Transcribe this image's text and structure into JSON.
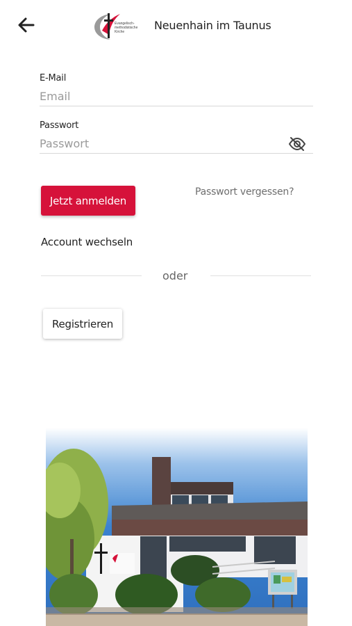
{
  "header": {
    "back_icon": "arrow-left-icon",
    "logo_text": [
      "Evangelisch-",
      "methodistische",
      "Kirche"
    ],
    "title": "Neuenhain im Taunus"
  },
  "login": {
    "email_label": "E-Mail",
    "email_placeholder": "Email",
    "email_value": "",
    "password_label": "Passwort",
    "password_placeholder": "Passwort",
    "password_value": "",
    "visibility_icon": "eye-off-icon",
    "submit_label": "Jetzt anmelden",
    "forgot_label": "Passwort vergessen?",
    "switch_label": "Account wechseln",
    "or_label": "oder",
    "register_label": "Registrieren"
  },
  "colors": {
    "accent": "#d6123a",
    "brand_grey": "#9a9a9a"
  }
}
